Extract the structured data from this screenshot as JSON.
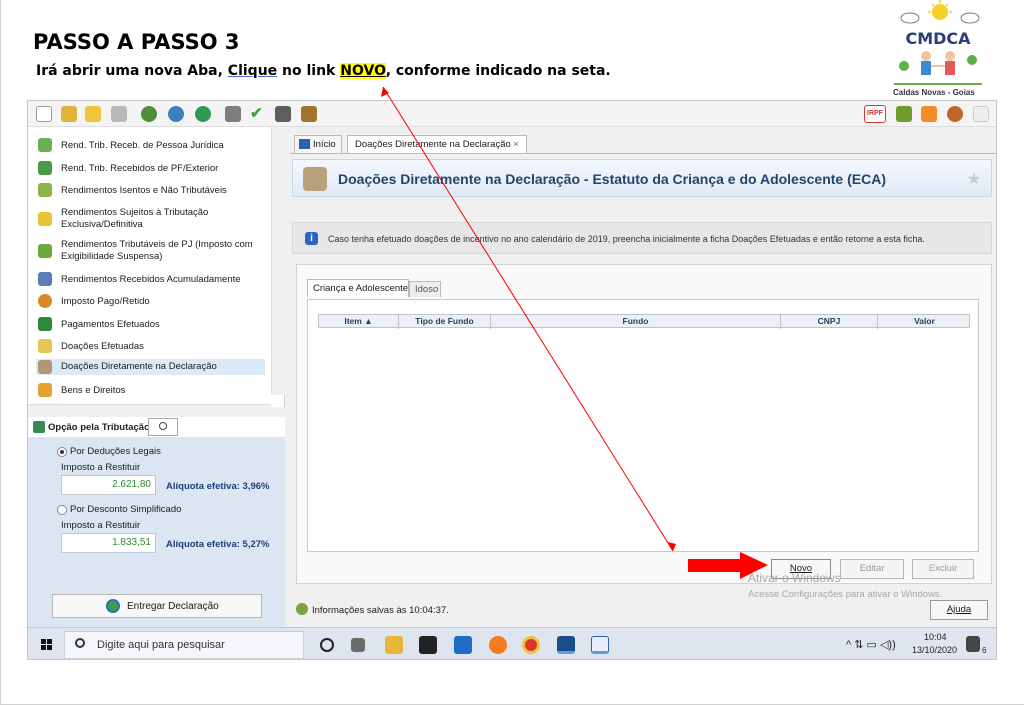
{
  "heading": "PASSO A PASSO 3",
  "instruction": {
    "before": "Irá abrir uma nova Aba,",
    "clique": "Clique",
    "middle": " no link",
    "novo": "NOVO",
    "after": ", conforme indicado na seta."
  },
  "logo": {
    "caption": "Caldas Novas - Goias",
    "letters": "CMDCA"
  },
  "sidebar": {
    "items": [
      {
        "label": "Rend. Trib. Receb. de Pessoa Jurídica"
      },
      {
        "label": "Rend. Trib. Recebidos de PF/Exterior"
      },
      {
        "label": "Rendimentos Isentos e Não Tributáveis"
      },
      {
        "label_line1": "Rendimentos Sujeitos à Tributação",
        "label_line2": "Exclusiva/Definitiva"
      },
      {
        "label_line1": "Rendimentos Tributáveis de PJ (Imposto com",
        "label_line2": "Exigibilidade Suspensa)"
      },
      {
        "label": "Rendimentos Recebidos Acumuladamente"
      },
      {
        "label": "Imposto Pago/Retido"
      },
      {
        "label": "Pagamentos Efetuados"
      },
      {
        "label": "Doações Efetuadas"
      },
      {
        "label": "Doações Diretamente na Declaração"
      },
      {
        "label": "Bens e Direitos"
      }
    ]
  },
  "tax_panel": {
    "header": "Opção pela Tributação:",
    "option1": {
      "label": "Por Deduções Legais",
      "sublabel": "Imposto a Restituir",
      "value": "2.621,80",
      "rate": "Alíquota efetiva: 3,96%"
    },
    "option2": {
      "label": "Por Desconto Simplificado",
      "sublabel": "Imposto a Restituir",
      "value": "1.833,51",
      "rate": "Alíquota efetiva: 5,27%"
    },
    "deliver_button": "Entregar Declaração"
  },
  "tabs": [
    {
      "label": "Início"
    },
    {
      "label": "Doações Diretamente na Declaração",
      "close": "×"
    }
  ],
  "page_title": "Doações Diretamente na Declaração - Estatuto da Criança e do Adolescente (ECA)",
  "info_text": "Caso tenha efetuado doações de incentivo no ano calendário de 2019, preencha inicialmente a ficha Doações Efetuadas e então retorne a esta ficha.",
  "subtabs": [
    "Criança e Adolescente",
    "Idoso"
  ],
  "table": {
    "columns": [
      "Item ▲",
      "Tipo de Fundo",
      "Fundo",
      "CNPJ",
      "Valor"
    ]
  },
  "buttons": {
    "novo": "Novo",
    "editar": "Editar",
    "excluir": "Excluir",
    "ajuda": "Ajuda"
  },
  "status": "Informações salvas às 10:04:37.",
  "watermark": {
    "line1": "Ativar o Windows",
    "line2": "Acesse Configurações para ativar o Windows."
  },
  "toolbar_right": {
    "irpf_label": "IRPF"
  },
  "taskbar": {
    "search_placeholder": "Digite aqui para pesquisar",
    "time": "10:04",
    "date": "13/10/2020",
    "notifications": "6"
  },
  "colors": {
    "annotation_red": "#ff0000",
    "highlight_yellow": "#ffff00",
    "header_blue": "#23456e",
    "panel_blue": "#dbe6f2"
  }
}
